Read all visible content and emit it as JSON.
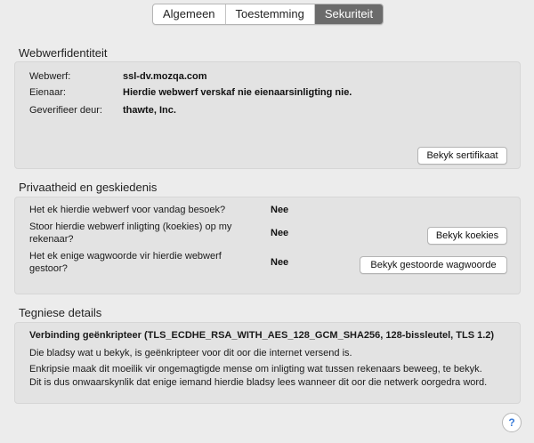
{
  "tabs": [
    {
      "label": "Algemeen"
    },
    {
      "label": "Toestemming"
    },
    {
      "label": "Sekuriteit"
    }
  ],
  "identity": {
    "title": "Webwerfidentiteit",
    "website_label": "Webwerf:",
    "website_value": "ssl-dv.mozqa.com",
    "owner_label": "Eienaar:",
    "owner_value": "Hierdie webwerf verskaf nie eienaarsinligting nie.",
    "verified_label": "Geverifieer deur:",
    "verified_value": "thawte, Inc.",
    "view_cert_button": "Bekyk sertifikaat"
  },
  "privacy": {
    "title": "Privaatheid en geskiedenis",
    "q1": "Het ek hierdie webwerf voor vandag besoek?",
    "a1": "Nee",
    "q2_line1": "Stoor hierdie webwerf inligting (koekies) op my",
    "q2_line2": "rekenaar?",
    "a2": "Nee",
    "cookies_button": "Bekyk koekies",
    "q3_line1": "Het ek enige wagwoorde vir hierdie webwerf",
    "q3_line2": "gestoor?",
    "a3": "Nee",
    "passwords_button": "Bekyk gestoorde wagwoorde"
  },
  "technical": {
    "title": "Tegniese details",
    "connection": "Verbinding geënkripteer (TLS_ECDHE_RSA_WITH_AES_128_GCM_SHA256, 128-bissleutel, TLS 1.2)",
    "line1": "Die bladsy wat u bekyk, is geënkripteer voor dit oor die internet versend is.",
    "line2": "Enkripsie maak dit moeilik vir ongemagtigde mense om inligting wat tussen rekenaars beweeg, te bekyk.",
    "line3": "Dit is dus onwaarskynlik dat enige iemand hierdie bladsy lees wanneer dit oor die netwerk oorgedra word."
  },
  "help": {
    "glyph": "?"
  }
}
